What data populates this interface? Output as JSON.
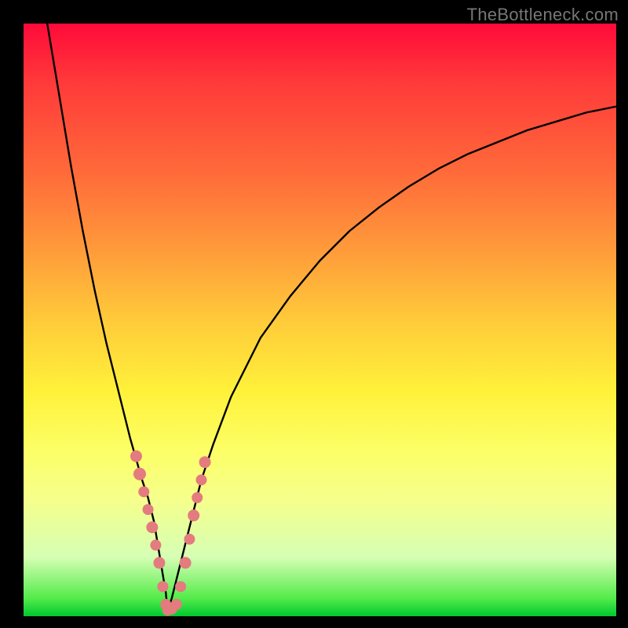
{
  "watermark": "TheBottleneck.com",
  "chart_data": {
    "type": "line",
    "title": "",
    "xlabel": "",
    "ylabel": "",
    "xlim": [
      0,
      100
    ],
    "ylim": [
      0,
      100
    ],
    "grid": false,
    "legend": false,
    "series": [
      {
        "name": "left-branch",
        "x": [
          4,
          6,
          8,
          10,
          12,
          14,
          16,
          18,
          19,
          20,
          21,
          22,
          22.5,
          23,
          23.5,
          24,
          24.3
        ],
        "values": [
          100,
          88,
          76,
          65,
          55,
          46,
          38,
          30,
          26.5,
          23,
          20,
          16,
          13,
          10,
          7,
          4,
          1
        ]
      },
      {
        "name": "right-branch",
        "x": [
          24.3,
          25,
          26,
          27,
          28,
          29,
          30,
          32,
          35,
          40,
          45,
          50,
          55,
          60,
          65,
          70,
          75,
          80,
          85,
          90,
          95,
          100
        ],
        "values": [
          1,
          3,
          7,
          11,
          15,
          19,
          23,
          29,
          37,
          47,
          54,
          60,
          65,
          69,
          72.5,
          75.5,
          78,
          80,
          82,
          83.5,
          85,
          86
        ]
      }
    ],
    "markers": [
      {
        "x": 19.0,
        "y": 27,
        "r": 7.5
      },
      {
        "x": 19.6,
        "y": 24,
        "r": 8.0
      },
      {
        "x": 20.3,
        "y": 21,
        "r": 7.0
      },
      {
        "x": 21.0,
        "y": 18,
        "r": 7.0
      },
      {
        "x": 21.7,
        "y": 15,
        "r": 7.5
      },
      {
        "x": 22.3,
        "y": 12,
        "r": 7.0
      },
      {
        "x": 22.9,
        "y": 9,
        "r": 7.5
      },
      {
        "x": 23.5,
        "y": 5,
        "r": 7.0
      },
      {
        "x": 24.0,
        "y": 2,
        "r": 7.0
      },
      {
        "x": 24.3,
        "y": 1,
        "r": 7.0
      },
      {
        "x": 25.0,
        "y": 1.2,
        "r": 7.0
      },
      {
        "x": 25.8,
        "y": 2,
        "r": 7.0
      },
      {
        "x": 26.5,
        "y": 5,
        "r": 7.0
      },
      {
        "x": 27.3,
        "y": 9,
        "r": 7.5
      },
      {
        "x": 28.0,
        "y": 13,
        "r": 7.0
      },
      {
        "x": 28.7,
        "y": 17,
        "r": 7.5
      },
      {
        "x": 29.3,
        "y": 20,
        "r": 7.0
      },
      {
        "x": 30.0,
        "y": 23,
        "r": 7.0
      },
      {
        "x": 30.6,
        "y": 26,
        "r": 7.5
      }
    ],
    "marker_color": "#e37b7f",
    "curve_color": "#000000",
    "curve_width": 2.4
  }
}
